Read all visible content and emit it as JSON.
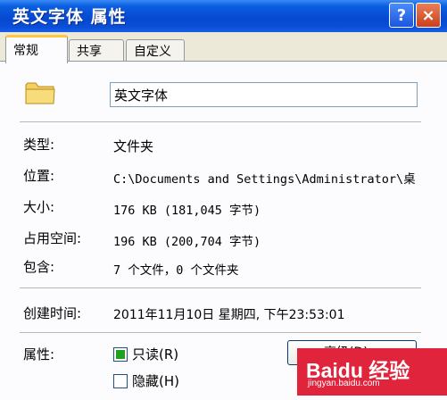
{
  "window": {
    "title": "英文字体 属性",
    "help_label": "?",
    "close_label": "×"
  },
  "tabs": [
    {
      "label": "常规",
      "active": true
    },
    {
      "label": "共享",
      "active": false
    },
    {
      "label": "自定义",
      "active": false
    }
  ],
  "general": {
    "folder_name": "英文字体",
    "type_label": "类型:",
    "type_value": "文件夹",
    "location_label": "位置:",
    "location_value": "C:\\Documents and Settings\\Administrator\\桌",
    "size_label": "大小:",
    "size_value": "176 KB (181,045 字节)",
    "size_on_disk_label": "占用空间:",
    "size_on_disk_value": "196 KB (200,704 字节)",
    "contains_label": "包含:",
    "contains_value": "7 个文件，0 个文件夹",
    "created_label": "创建时间:",
    "created_value": "2011年11月10日  星期四, 下午23:53:01",
    "attributes_label": "属性:",
    "readonly_label": "只读(R)",
    "hidden_label": "隐藏(H)",
    "advanced_label": "高级(D)..."
  },
  "watermark": {
    "logo": "Baidu 经验",
    "url": "jingyan.baidu.com"
  },
  "colors": {
    "titlebar": "#0648d0",
    "dialog_bg": "#ece9d8",
    "panel_bg": "#fcfcfe",
    "tab_accent": "#ffc83c",
    "watermark_bg": "#e0243c"
  }
}
